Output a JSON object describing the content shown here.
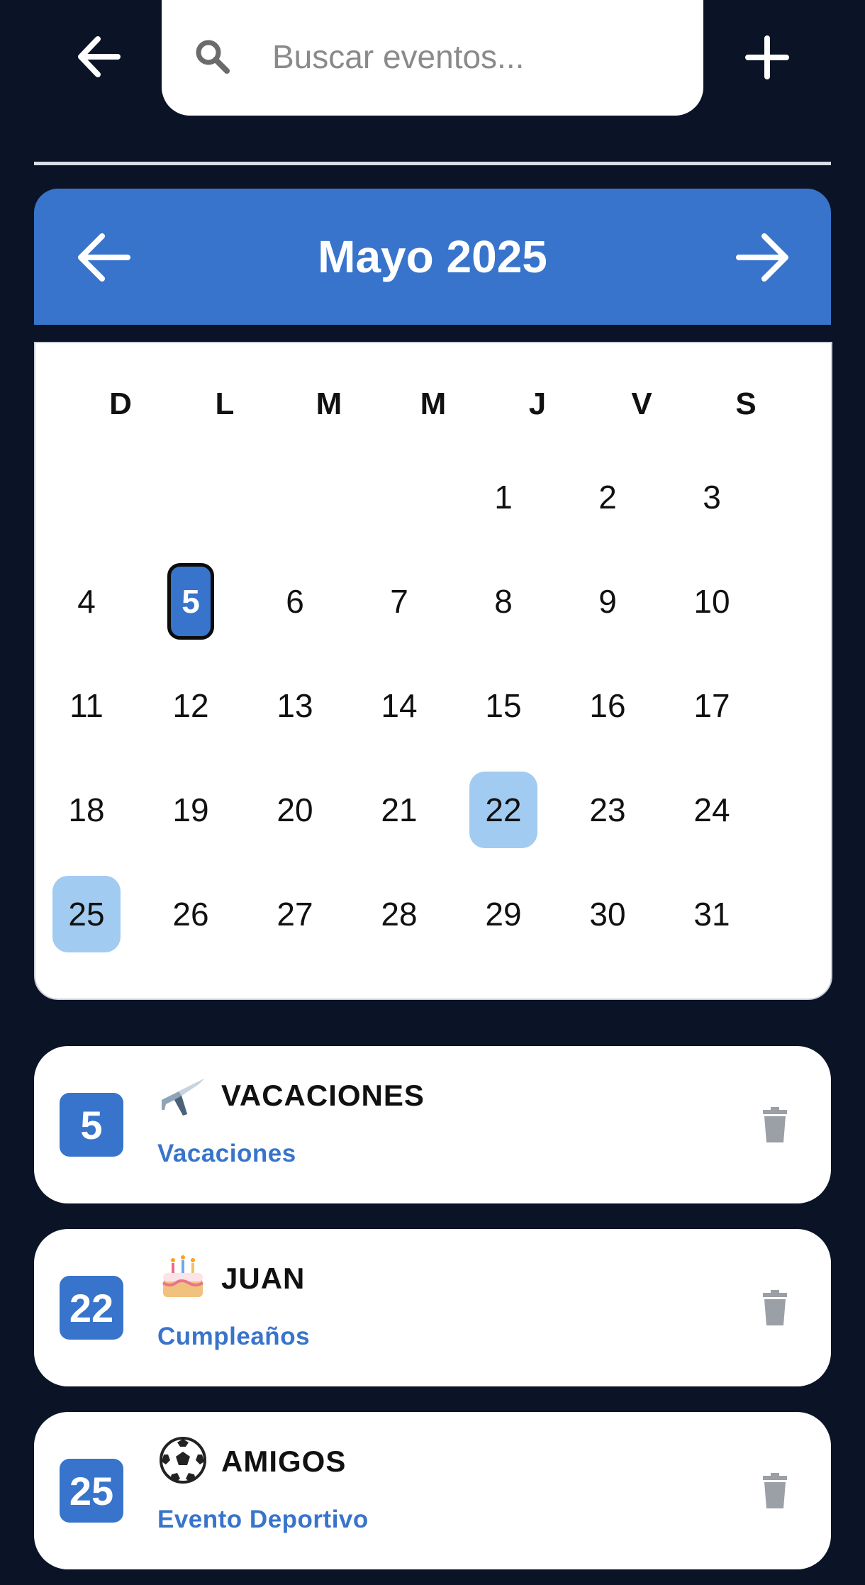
{
  "search": {
    "placeholder": "Buscar eventos...",
    "value": ""
  },
  "calendar": {
    "month_label": "Mayo 2025",
    "weekdays": [
      "D",
      "L",
      "M",
      "M",
      "J",
      "V",
      "S"
    ],
    "days": [
      "1",
      "2",
      "3",
      "4",
      "5",
      "6",
      "7",
      "8",
      "9",
      "10",
      "11",
      "12",
      "13",
      "14",
      "15",
      "16",
      "17",
      "18",
      "19",
      "20",
      "21",
      "22",
      "23",
      "24",
      "25",
      "26",
      "27",
      "28",
      "29",
      "30",
      "31"
    ],
    "selected_day": "5",
    "event_days": [
      "22",
      "25"
    ]
  },
  "events": [
    {
      "day": "5",
      "emoji": "airplane",
      "title": "VACACIONES",
      "subtitle": "Vacaciones"
    },
    {
      "day": "22",
      "emoji": "birthday-cake",
      "title": "JUAN",
      "subtitle": "Cumpleaños"
    },
    {
      "day": "25",
      "emoji": "soccer-ball",
      "title": "AMIGOS",
      "subtitle": "Evento Deportivo"
    }
  ],
  "colors": {
    "background": "#0b1427",
    "accent": "#3874cb",
    "event_highlight": "#a2cbf1",
    "muted": "#9aa0a6"
  },
  "icons": {
    "back": "arrow-left-icon",
    "add": "plus-icon",
    "search": "search-icon",
    "prev": "arrow-left-icon",
    "next": "arrow-right-icon",
    "delete": "trash-icon"
  }
}
